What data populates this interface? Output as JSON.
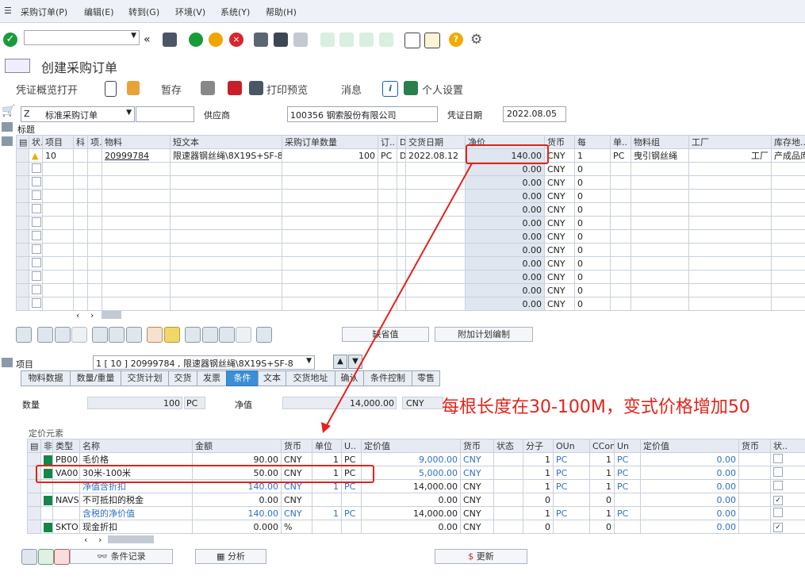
{
  "menu": [
    "采购订单(P)",
    "编辑(E)",
    "转到(G)",
    "环境(V)",
    "系统(Y)",
    "帮助(H)"
  ],
  "page_title": "创建采购订单",
  "app_toolbar": {
    "overview": "凭证概览打开",
    "hold": "暂存",
    "print_preview": "打印预览",
    "messages": "消息",
    "personal_settings": "个人设置"
  },
  "header": {
    "doc_type": "Z",
    "doc_type_text": "标准采购订单",
    "vendor_label": "供应商",
    "vendor_value": "100356 钢索股份有限公司",
    "doc_date_label": "凭证日期",
    "doc_date": "2022.08.05",
    "section_title": "标题"
  },
  "items_columns": [
    "状.",
    "项目",
    "科",
    "项.",
    "物料",
    "短文本",
    "采购订单数量",
    "订..",
    "D",
    "交货日期",
    "净价",
    "货币",
    "每",
    "单..",
    "物料组",
    "工厂",
    "库存地.."
  ],
  "item_row": {
    "status_icon": "warning-icon",
    "item": "10",
    "material": "20999784",
    "short_text": "限速器钢丝绳\\8X19S+SF-8",
    "qty": "100",
    "unit": "PC",
    "d": "D",
    "delivery": "2022.08.12",
    "net_price": "140.00",
    "currency": "CNY",
    "per": "1",
    "unit2": "PC",
    "mat_group": "曳引钢丝绳",
    "plant": "工厂",
    "storage": "产成品库"
  },
  "empty_rows": [
    {
      "price": "0.00",
      "cur": "CNY",
      "per": "0"
    },
    {
      "price": "0.00",
      "cur": "CNY",
      "per": "0"
    },
    {
      "price": "0.00",
      "cur": "CNY",
      "per": "0"
    },
    {
      "price": "0.00",
      "cur": "CNY",
      "per": "0"
    },
    {
      "price": "0.00",
      "cur": "CNY",
      "per": "0"
    },
    {
      "price": "0.00",
      "cur": "CNY",
      "per": "0"
    },
    {
      "price": "0.00",
      "cur": "CNY",
      "per": "0"
    },
    {
      "price": "0.00",
      "cur": "CNY",
      "per": "0"
    },
    {
      "price": "0.00",
      "cur": "CNY",
      "per": "0"
    },
    {
      "price": "0.00",
      "cur": "CNY",
      "per": "0"
    },
    {
      "price": "0.00",
      "cur": "CNY",
      "per": "0"
    }
  ],
  "item_buttons": {
    "default_values": "缺省值",
    "add_planning": "附加计划编制"
  },
  "item_detail": {
    "label": "项目",
    "selector": "1 [ 10 ] 20999784 , 限速器钢丝绳\\8X19S+SF-8"
  },
  "tabs": [
    "物料数据",
    "数量/重量",
    "交货计划",
    "交货",
    "发票",
    "条件",
    "文本",
    "交货地址",
    "确认",
    "条件控制",
    "零售"
  ],
  "qty_section": {
    "qty_label": "数量",
    "qty_value": "100",
    "qty_unit": "PC",
    "net_label": "净值",
    "net_value": "14,000.00",
    "net_cur": "CNY"
  },
  "annotation": "每根长度在30-100M，变式价格增加50",
  "pricing": {
    "title": "定价元素",
    "columns": [
      "非.",
      "类型",
      "名称",
      "金额",
      "货币",
      "单位",
      "U..",
      "定价值",
      "货币",
      "状态",
      "分子",
      "OUn",
      "CConDe",
      "Un",
      "定价值",
      "货币",
      "状.."
    ],
    "rows": [
      {
        "sq": true,
        "type": "PB00",
        "name": "毛价格",
        "amount": "90.00",
        "cur": "CNY",
        "per": "1",
        "unit": "PC",
        "value": "9,000.00",
        "vcur": "CNY",
        "num": "1",
        "oun": "PC",
        "ccon": "1",
        "un": "PC",
        "val2": "0.00",
        "check": ""
      },
      {
        "sq": true,
        "type": "VA00",
        "name": "30米-100米",
        "amount": "50.00",
        "cur": "CNY",
        "per": "1",
        "unit": "PC",
        "value": "5,000.00",
        "vcur": "CNY",
        "num": "1",
        "oun": "PC",
        "ccon": "1",
        "un": "PC",
        "val2": "0.00",
        "check": ""
      },
      {
        "sq": false,
        "type": "",
        "name": "净值含折扣",
        "amount": "140.00",
        "cur": "CNY",
        "per": "1",
        "unit": "PC",
        "value": "14,000.00",
        "vcur": "CNY",
        "num": "1",
        "oun": "PC",
        "ccon": "1",
        "un": "PC",
        "val2": "0.00",
        "check": ""
      },
      {
        "sq": true,
        "type": "NAVS",
        "name": "不可抵扣的税金",
        "amount": "0.00",
        "cur": "CNY",
        "per": "",
        "unit": "",
        "value": "0.00",
        "vcur": "CNY",
        "num": "0",
        "oun": "",
        "ccon": "0",
        "un": "",
        "val2": "0.00",
        "check": "✓"
      },
      {
        "sq": false,
        "type": "",
        "name": "含税的净价值",
        "amount": "140.00",
        "cur": "CNY",
        "per": "1",
        "unit": "PC",
        "value": "14,000.00",
        "vcur": "CNY",
        "num": "1",
        "oun": "PC",
        "ccon": "1",
        "un": "PC",
        "val2": "0.00",
        "check": ""
      },
      {
        "sq": true,
        "type": "SKTO",
        "name": "现金折扣",
        "amount": "0.000",
        "cur": "%",
        "per": "",
        "unit": "",
        "value": "0.00",
        "vcur": "CNY",
        "num": "0",
        "oun": "",
        "ccon": "0",
        "un": "",
        "val2": "0.00",
        "check": "✓"
      }
    ]
  },
  "bottom_buttons": {
    "cond_record": "条件记录",
    "analysis": "分析",
    "update": "更新"
  },
  "colors": {
    "accent_red": "#e2231a",
    "active_tab": "#3a8fd6",
    "condition_green": "#14864a"
  }
}
